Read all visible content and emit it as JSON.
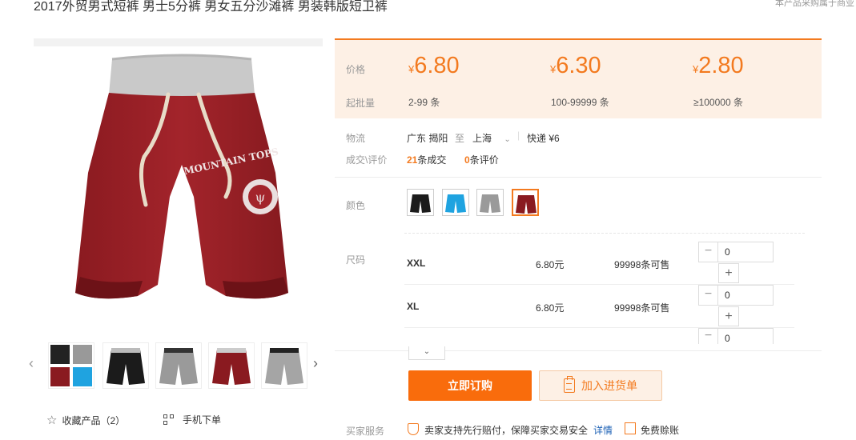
{
  "header": {
    "title": "2017外贸男式短裤 男士5分裤 男女五分沙滩裤 男装韩版短卫裤",
    "note": "本产品采购属于商业"
  },
  "gallery": {
    "graphic_text": "MOUNTAIN TOPS",
    "favorite_label": "收藏产品（2）",
    "mobile_label": "手机下单",
    "thumbnails": [
      "多色组合",
      "黑色",
      "灰色",
      "酒红色",
      "灰色2"
    ]
  },
  "price": {
    "price_label": "价格",
    "qty_label": "起批量",
    "tiers": [
      {
        "currency": "¥",
        "price": "6.80",
        "qty": "2-99 条"
      },
      {
        "currency": "¥",
        "price": "6.30",
        "qty": "100-99999 条"
      },
      {
        "currency": "¥",
        "price": "2.80",
        "qty": "≥100000 条"
      }
    ]
  },
  "logistics": {
    "label": "物流",
    "from": "广东 揭阳",
    "to_word": "至",
    "to": "上海",
    "express": "快递 ¥6"
  },
  "deals": {
    "label": "成交\\评价",
    "deals_count": "21",
    "deals_text": "条成交",
    "reviews_count": "0",
    "reviews_text": "条评价"
  },
  "color": {
    "label": "颜色",
    "options": [
      "黑色",
      "蓝色",
      "灰色",
      "酒红色"
    ],
    "selected": "酒红色"
  },
  "sizes": {
    "label": "尺码",
    "unit_suffix": "元",
    "rows": [
      {
        "size": "XXL",
        "price": "6.80元",
        "stock": "99998条可售",
        "qty": "0"
      },
      {
        "size": "XL",
        "price": "6.80元",
        "stock": "99998条可售",
        "qty": "0"
      },
      {
        "qty": "0"
      }
    ]
  },
  "actions": {
    "buy_label": "立即订购",
    "cart_label": "加入进货单",
    "expand_icon": "chevron-down"
  },
  "services": {
    "label": "买家服务",
    "guarantee": "卖家支持先行赔付，保障买家交易安全",
    "details_link": "详情",
    "free_bill": "免费赊账"
  },
  "colors": {
    "accent": "#f37a1f",
    "button": "#f96c0c",
    "price_bg": "#fdf0e5"
  }
}
